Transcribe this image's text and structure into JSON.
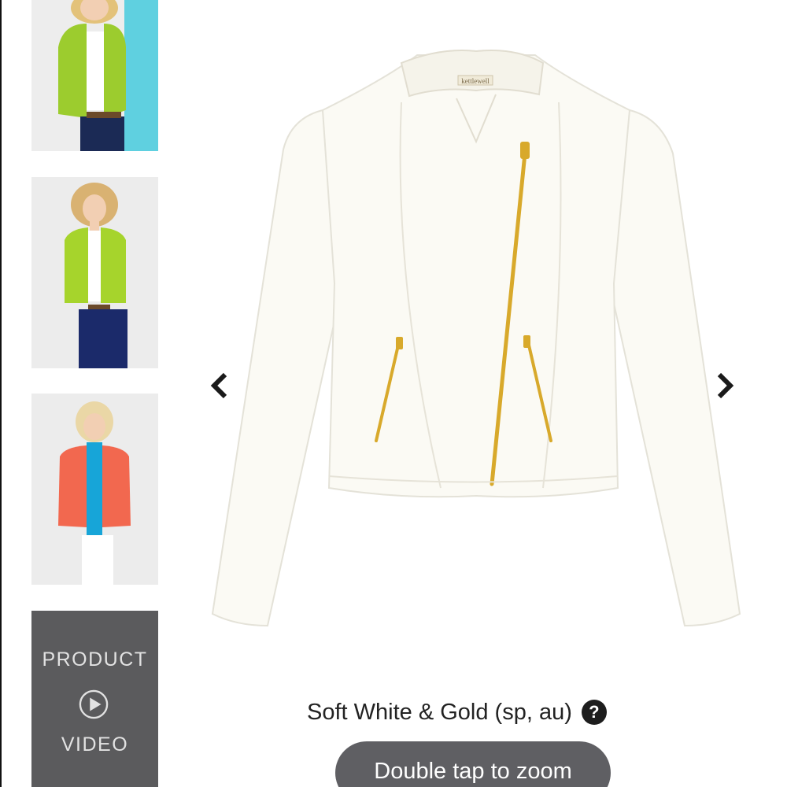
{
  "thumbnails": [
    {
      "name": "lime-jacket-model-front",
      "jacket_color": "#9ccc2e",
      "backdrop": "#5fd0e0"
    },
    {
      "name": "lime-jacket-model-hair",
      "jacket_color": "#a6d42c",
      "backdrop": "#ececec"
    },
    {
      "name": "coral-jacket-model",
      "jacket_color": "#f2684f",
      "backdrop": "#ececec"
    }
  ],
  "video_tile": {
    "top_label": "PRODUCT",
    "bottom_label": "VIDEO",
    "icon": "play-icon"
  },
  "main_image": {
    "subject": "soft white moto jacket with gold zips",
    "brand_tag": "kettlewell",
    "fabric_color": "#fbfaf4",
    "zip_color": "#d8a92b"
  },
  "navigation": {
    "prev_icon": "chevron-left-icon",
    "next_icon": "chevron-right-icon"
  },
  "color_label": "Soft White & Gold (sp, au)",
  "help_icon": "?",
  "zoom_hint": "Double tap to zoom"
}
